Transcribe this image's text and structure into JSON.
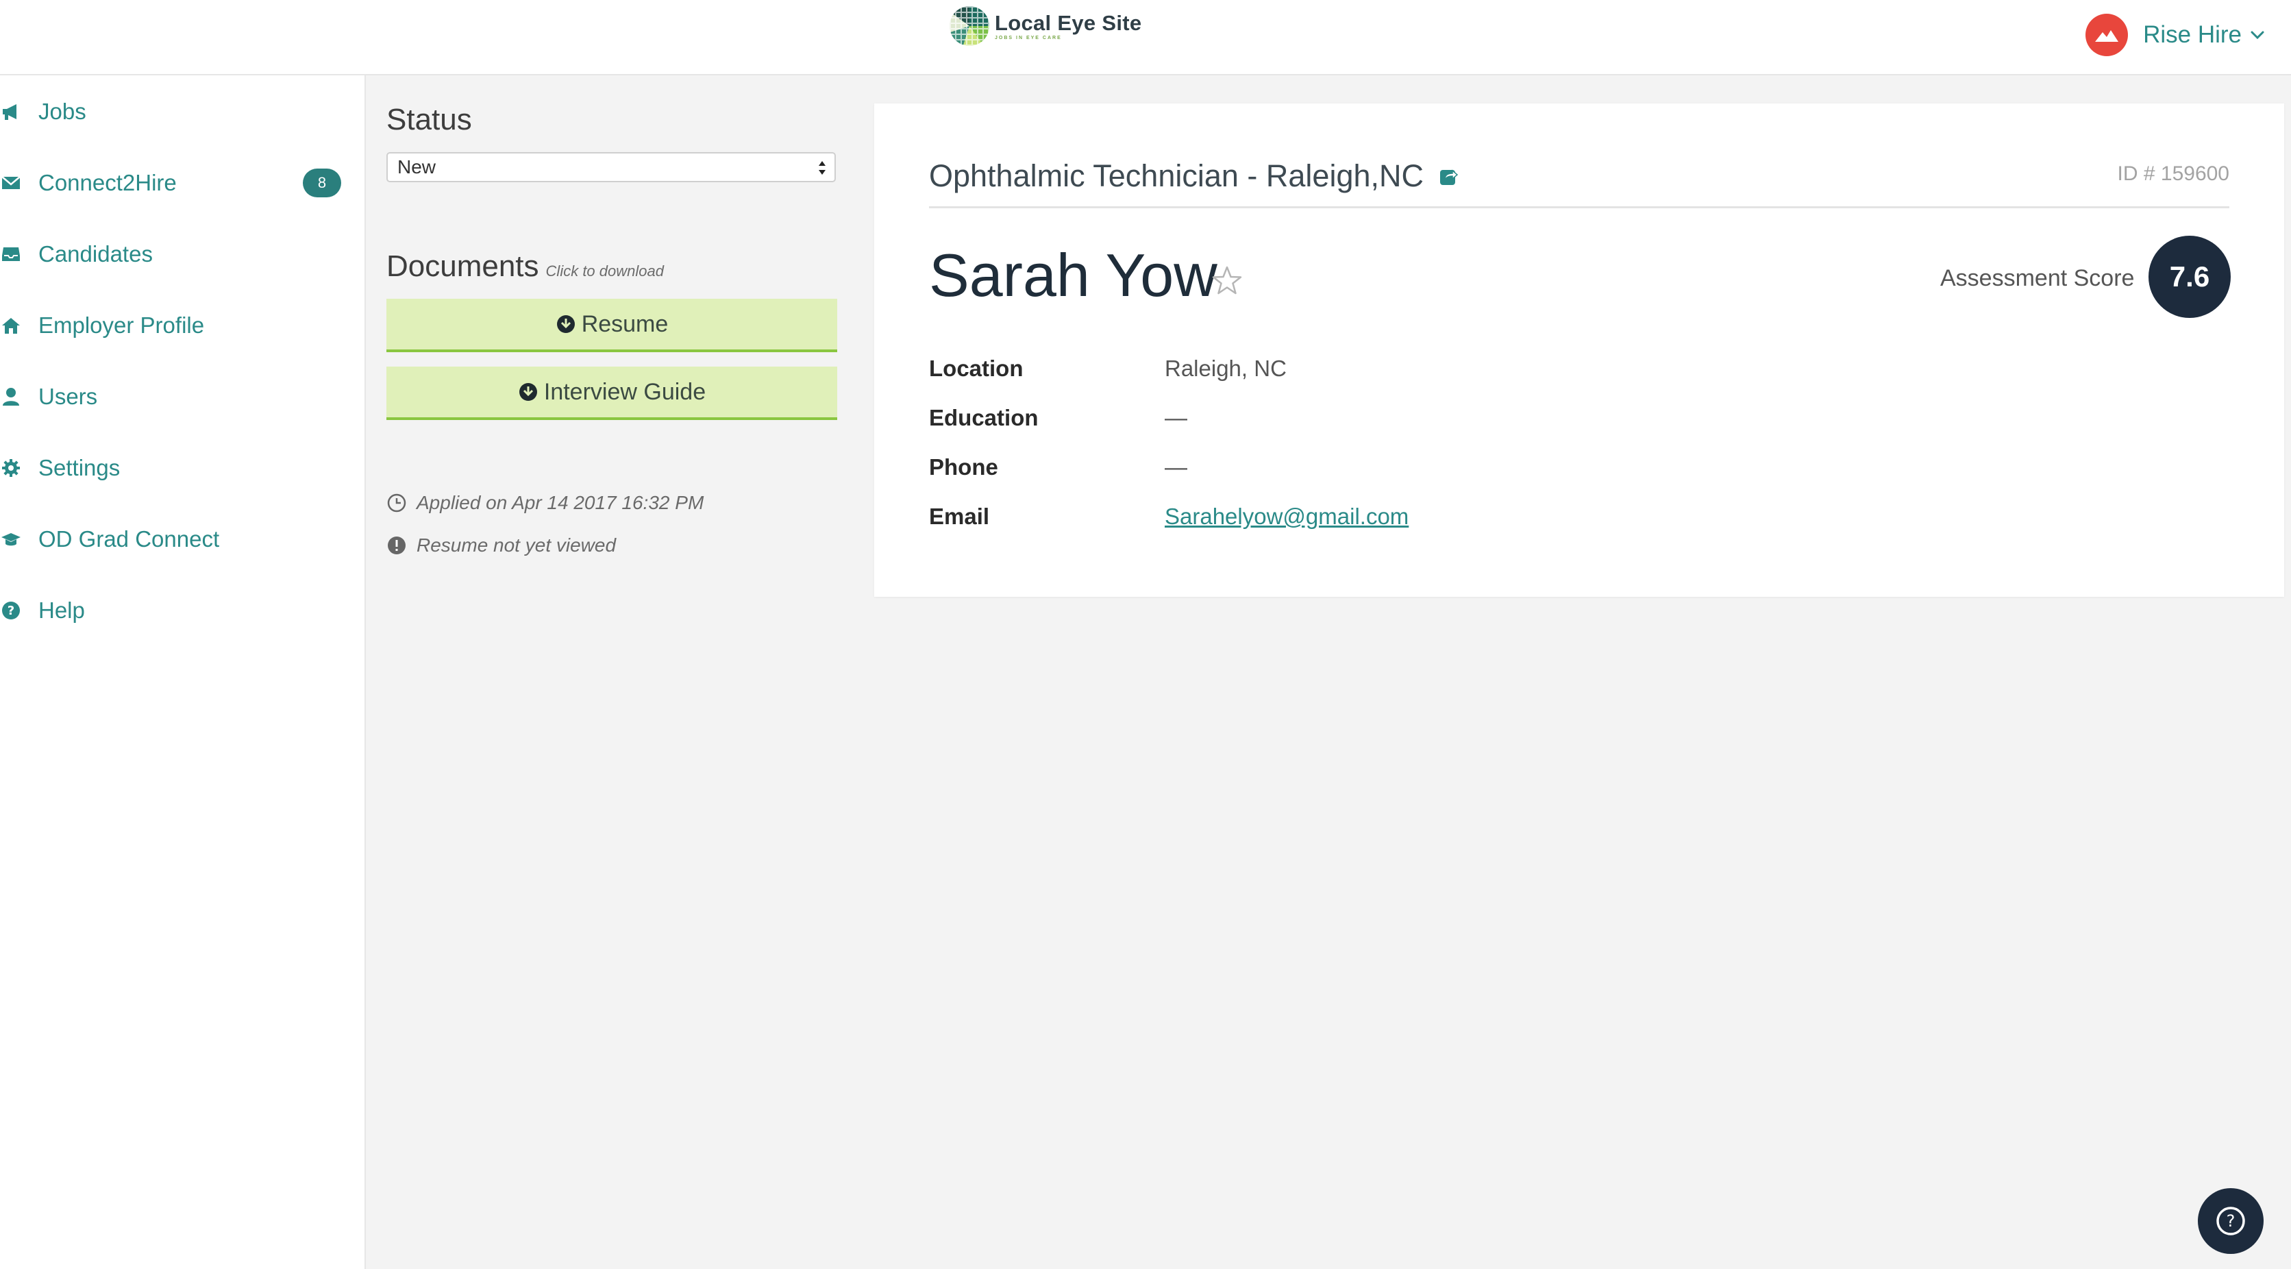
{
  "brand": {
    "title": "Local Eye Site",
    "subtitle": "JOBS IN EYE CARE"
  },
  "user_menu": {
    "name": "Rise Hire"
  },
  "sidebar": {
    "items": [
      {
        "label": "Jobs",
        "icon": "megaphone-icon"
      },
      {
        "label": "Connect2Hire",
        "icon": "envelope-icon",
        "badge": "8"
      },
      {
        "label": "Candidates",
        "icon": "inbox-icon"
      },
      {
        "label": "Employer Profile",
        "icon": "home-icon"
      },
      {
        "label": "Users",
        "icon": "user-icon"
      },
      {
        "label": "Settings",
        "icon": "gear-icon"
      },
      {
        "label": "OD Grad Connect",
        "icon": "graduation-cap-icon"
      },
      {
        "label": "Help",
        "icon": "question-circle-icon"
      }
    ]
  },
  "status": {
    "heading": "Status",
    "selected": "New"
  },
  "documents": {
    "heading": "Documents",
    "hint": "Click to download",
    "buttons": [
      "Resume",
      "Interview Guide"
    ]
  },
  "meta": {
    "applied": "Applied on Apr 14 2017 16:32 PM",
    "viewed": "Resume not yet viewed"
  },
  "candidate": {
    "job_title": "Ophthalmic Technician - Raleigh,NC",
    "job_id": "ID # 159600",
    "name": "Sarah Yow",
    "score_label": "Assessment Score",
    "score": "7.6",
    "fields": [
      {
        "label": "Location",
        "value": "Raleigh, NC"
      },
      {
        "label": "Education",
        "value": "—"
      },
      {
        "label": "Phone",
        "value": "—"
      },
      {
        "label": "Email",
        "value": "Sarahelyow@gmail.com"
      }
    ]
  },
  "colors": {
    "accent": "#2a8a88",
    "navy": "#1d2b3d",
    "doc_button_bg": "#e0f0b9",
    "doc_button_border": "#8ac640",
    "avatar": "#e8463c"
  }
}
